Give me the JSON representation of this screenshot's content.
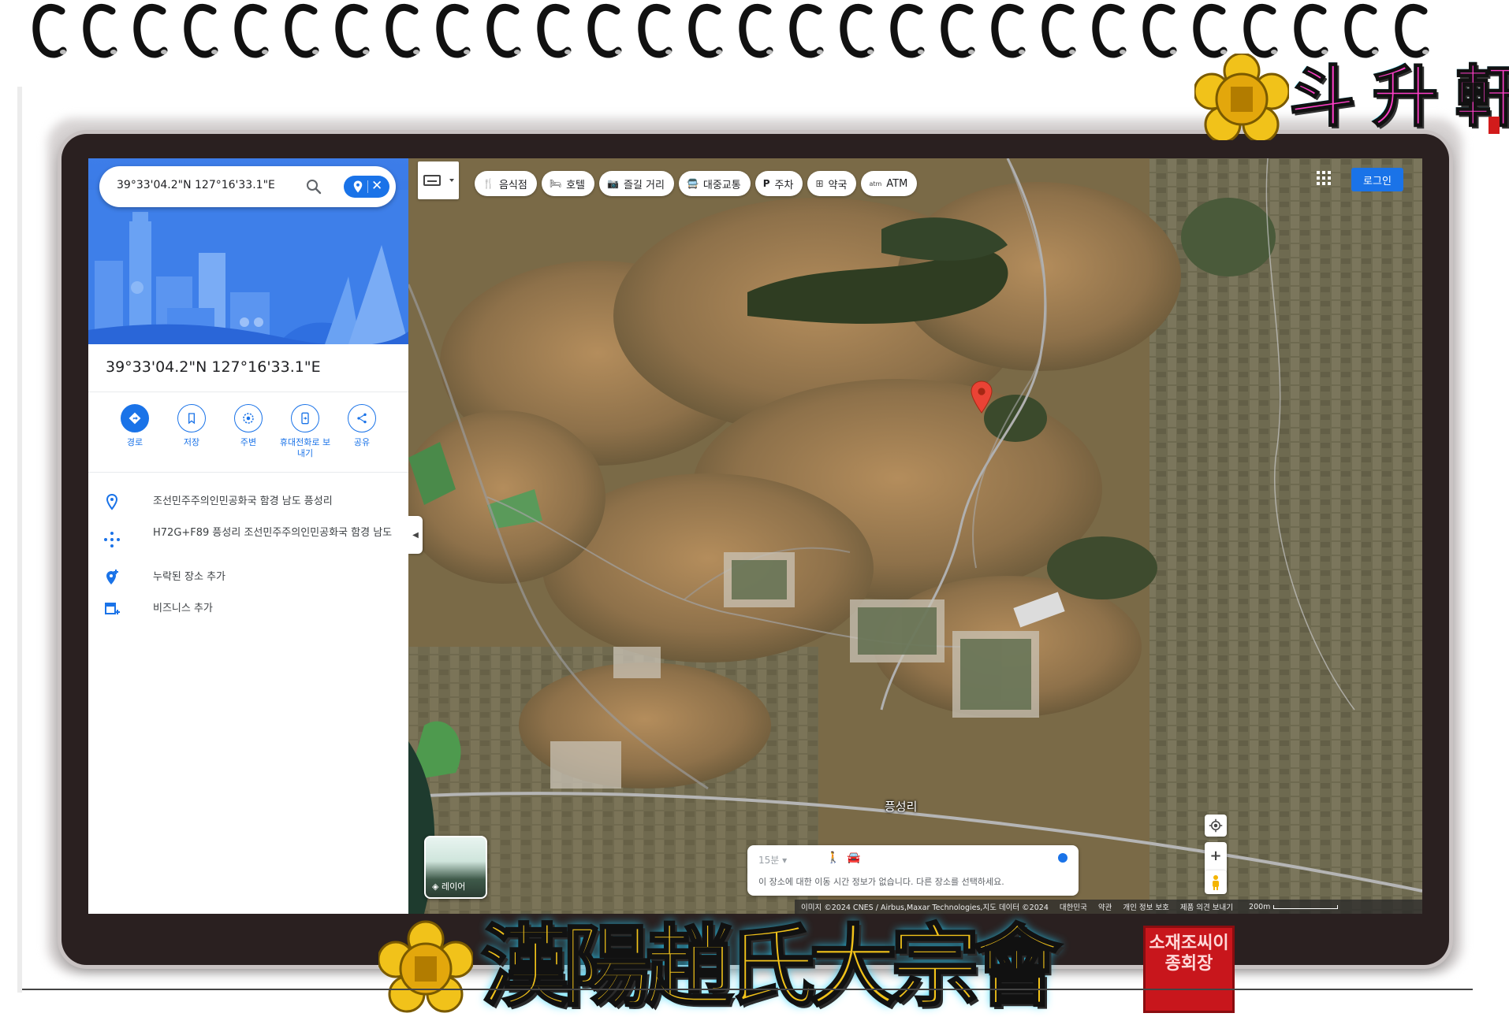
{
  "search": {
    "query": "39°33'04.2\"N 127°16'33.1\"E",
    "clear_label": "✕"
  },
  "place": {
    "title": "39°33'04.2\"N 127°16'33.1\"E"
  },
  "actions": [
    {
      "label": "경로",
      "icon": "directions-icon"
    },
    {
      "label": "저장",
      "icon": "bookmark-icon"
    },
    {
      "label": "주변",
      "icon": "nearby-icon"
    },
    {
      "label": "휴대전화로 보내기",
      "icon": "send-to-phone-icon"
    },
    {
      "label": "공유",
      "icon": "share-icon"
    }
  ],
  "info": {
    "address": "조선민주주의인민공화국 함경 남도 픙성리",
    "plus_code": "H72G+F89 픙성리 조선민주주의인민공화국 함경 남도",
    "add_missing_place": "누락된 장소 추가",
    "add_business": "비즈니스 추가"
  },
  "chips": [
    {
      "label": "음식점",
      "icon": "restaurant-icon"
    },
    {
      "label": "호텔",
      "icon": "hotel-icon"
    },
    {
      "label": "즐길 거리",
      "icon": "camera-icon"
    },
    {
      "label": "대중교통",
      "icon": "transit-icon"
    },
    {
      "label": "주차",
      "icon": "parking-icon"
    },
    {
      "label": "약국",
      "icon": "pharmacy-icon"
    },
    {
      "label": "ATM",
      "icon": "atm-icon"
    }
  ],
  "header": {
    "login_label": "로그인"
  },
  "map": {
    "village_label": "픙성리",
    "layers_label": "레이어"
  },
  "travel": {
    "time_label": "15분",
    "message": "이 장소에 대한 이동 시간 정보가 없습니다. 다른 장소를 선택하세요."
  },
  "footer": {
    "imagery": "이미지 ©2024 CNES / Airbus,Maxar Technologies,지도 데이터 ©2024",
    "country": "대한민국",
    "terms": "약관",
    "privacy": "개인 정보 보호",
    "feedback": "제품 의견 보내기",
    "scale": "200m"
  },
  "branding": {
    "top_logo_text": "斗 升 軒",
    "bottom_banner_text": "漢陽趙氏大宗會",
    "seal_text": "소재조씨이종회장"
  },
  "colors": {
    "accent": "#1a73e8",
    "marker": "#ea4335",
    "banner_gold": "#f1c21a",
    "logo_pink": "#ff3ec8",
    "seal_red": "#c8161c"
  }
}
